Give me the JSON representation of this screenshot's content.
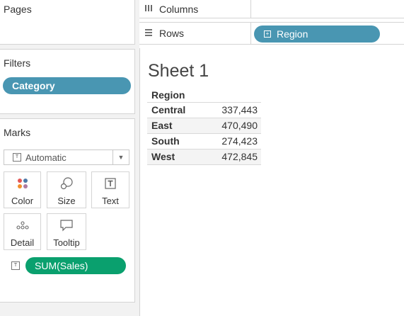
{
  "cards": {
    "pages": {
      "title": "Pages"
    },
    "filters": {
      "title": "Filters",
      "pills": [
        "Category"
      ]
    },
    "marks": {
      "title": "Marks",
      "mark_type": "Automatic",
      "buttons": [
        {
          "label": "Color",
          "icon": "color-icon"
        },
        {
          "label": "Size",
          "icon": "size-icon"
        },
        {
          "label": "Text",
          "icon": "text-icon"
        },
        {
          "label": "Detail",
          "icon": "detail-icon"
        },
        {
          "label": "Tooltip",
          "icon": "tooltip-icon"
        }
      ],
      "field_pill": "SUM(Sales)"
    }
  },
  "shelves": {
    "columns": {
      "label": "Columns",
      "pills": []
    },
    "rows": {
      "label": "Rows",
      "pills": [
        "Region"
      ]
    }
  },
  "sheet": {
    "title": "Sheet 1",
    "table": {
      "header": "Region",
      "rows": [
        {
          "label": "Central",
          "value": "337,443"
        },
        {
          "label": "East",
          "value": "470,490"
        },
        {
          "label": "South",
          "value": "274,423"
        },
        {
          "label": "West",
          "value": "472,845"
        }
      ]
    }
  },
  "colors": {
    "dimension_pill": "#4996b2",
    "measure_pill": "#0aa06e"
  }
}
